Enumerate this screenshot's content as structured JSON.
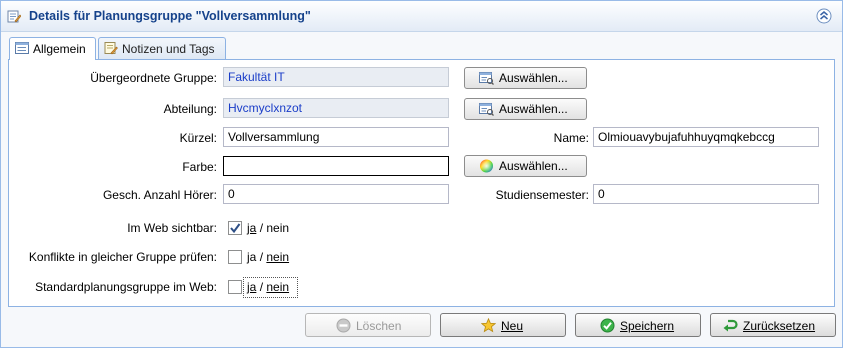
{
  "header": {
    "title": "Details für Planungsgruppe \"Vollversammlung\"",
    "icon": "form-edit-icon",
    "collapse_icon": "chevron-double-up-icon"
  },
  "tabs": [
    {
      "label": "Allgemein",
      "icon": "form-icon",
      "active": true
    },
    {
      "label": "Notizen und Tags",
      "icon": "note-edit-icon",
      "active": false
    }
  ],
  "form": {
    "parent_group": {
      "label": "Übergeordnete Gruppe:",
      "value": "Fakultät IT",
      "button": "Auswählen..."
    },
    "department": {
      "label": "Abteilung:",
      "value": "Hvcmyclxnzot",
      "button": "Auswählen..."
    },
    "short_name": {
      "label": "Kürzel:",
      "value": "Vollversammlung"
    },
    "name": {
      "label": "Name:",
      "value": "Olmiouavybujafuhhuyqmqkebccg"
    },
    "color": {
      "label": "Farbe:",
      "value": "",
      "button": "Auswählen..."
    },
    "listeners": {
      "label": "Gesch. Anzahl Hörer:",
      "value": "0"
    },
    "semester": {
      "label": "Studiensemester:",
      "value": "0"
    },
    "web_visible": {
      "label": "Im Web sichtbar:",
      "checked": true,
      "yes": "ja",
      "sep": "/",
      "no": "nein"
    },
    "check_conflicts": {
      "label": "Konflikte in gleicher Gruppe prüfen:",
      "checked": false,
      "yes": "ja",
      "sep": "/",
      "no": "nein"
    },
    "default_web": {
      "label": "Standardplanungsgruppe im Web:",
      "checked": false,
      "yes": "ja",
      "sep": "/",
      "no": "nein"
    }
  },
  "footer": {
    "delete": {
      "label": "Löschen",
      "icon": "minus-circle-icon",
      "enabled": false
    },
    "new": {
      "label": "Neu",
      "icon": "star-icon"
    },
    "save": {
      "label": "Speichern",
      "icon": "check-circle-icon"
    },
    "reset": {
      "label": "Zurücksetzen",
      "icon": "undo-arrow-icon"
    }
  },
  "colors": {
    "header_text": "#15428b",
    "readonly_text": "#1a3dc8",
    "panel_border": "#99bbe8"
  }
}
